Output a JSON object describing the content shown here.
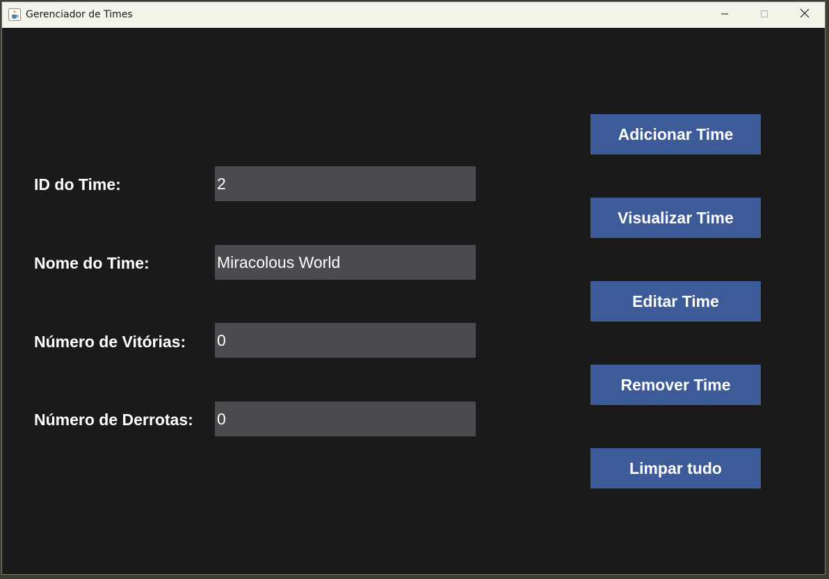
{
  "window": {
    "title": "Gerenciador de Times",
    "app_icon": "java-cup-icon",
    "controls": [
      "minimize-icon",
      "maximize-icon",
      "close-icon"
    ]
  },
  "form": {
    "id_label": "ID do Time:",
    "id_value": "2",
    "name_label": "Nome do Time:",
    "name_value": "Miracolous World",
    "wins_label": "Número de Vitórias:",
    "wins_value": "0",
    "losses_label": "Número de Derrotas:",
    "losses_value": "0"
  },
  "actions": {
    "add_label": "Adicionar Time",
    "view_label": "Visualizar Time",
    "edit_label": "Editar Time",
    "remove_label": "Remover Time",
    "clear_label": "Limpar tudo"
  },
  "colors": {
    "background": "#1a1a1b",
    "field": "#4b4b4f",
    "button": "#3d5a99",
    "titlebar": "#f3f3e8"
  }
}
